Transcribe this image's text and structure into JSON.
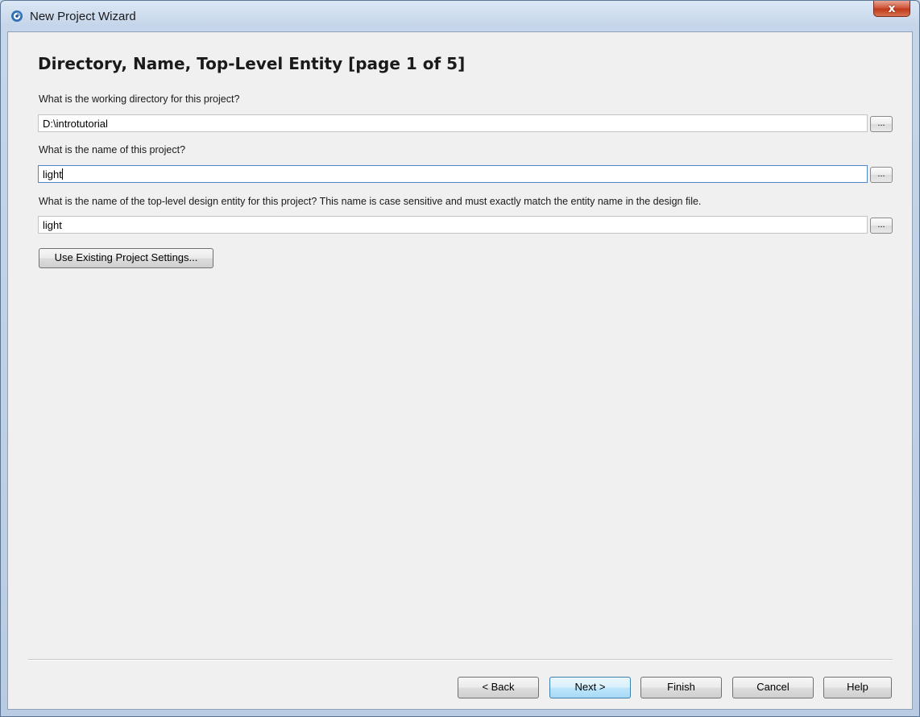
{
  "window": {
    "title": "New Project Wizard",
    "app_icon": "quartus-app-icon",
    "close_glyph": "x"
  },
  "page": {
    "title": "Directory, Name, Top-Level Entity [page 1 of 5]"
  },
  "fields": {
    "working_dir": {
      "label": "What is the working directory for this project?",
      "value": "D:\\introtutorial",
      "browse_label": "..."
    },
    "project_name": {
      "label": "What is the name of this project?",
      "value": "light",
      "browse_label": "..."
    },
    "top_level": {
      "label": "What is the name of the top-level design entity for this project? This name is case sensitive and must exactly match the entity name in the design file.",
      "value": "light",
      "browse_label": "..."
    }
  },
  "use_existing_button": "Use Existing Project Settings...",
  "footer": {
    "back": "< Back",
    "next": "Next >",
    "finish": "Finish",
    "cancel": "Cancel",
    "help": "Help"
  }
}
